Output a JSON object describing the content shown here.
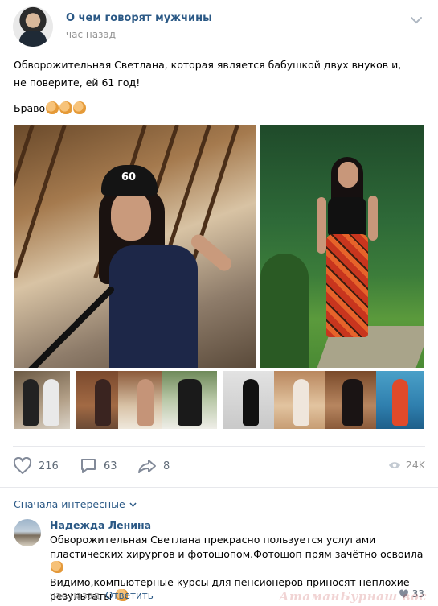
{
  "post": {
    "author": "О чем говорят мужчины",
    "time": "час назад",
    "text_line1": "Обворожительная Светлана, которая является бабушкой двух внуков и, не поверите, ей 61 год!",
    "text_bravo": "Браво",
    "cap_number": "60"
  },
  "actions": {
    "likes": "216",
    "comments": "63",
    "shares": "8",
    "views": "24K"
  },
  "comments_section": {
    "sort_label": "Сначала интересные",
    "comment": {
      "author": "Надежда Ленина",
      "text_part1": "Обворожительная Светлана прекрасно пользуется услугами пластических хирургов и фотошопом.Фотошоп прям зачётно освоила",
      "text_part2": "Видимо,компьютерные курсы для пенсионеров приносят неплохие результаты",
      "time": "час назад",
      "reply_label": "Ответить",
      "likes": "33"
    }
  },
  "watermark": "АтаманБурнаш вос",
  "colors": {
    "link": "#2a5885",
    "muted": "#939393",
    "action": "#626d7a"
  }
}
